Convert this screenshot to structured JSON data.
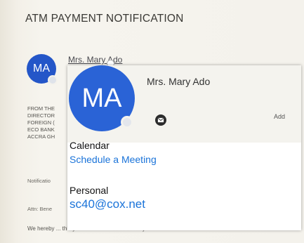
{
  "email": {
    "title": "ATM PAYMENT NOTIFICATION",
    "sender_initials": "MA",
    "sender_name": "Mrs. Mary Ado",
    "body_lines": [
      "FROM THE",
      "DIRECTOR",
      "FOREIGN (",
      "ECO BANK",
      "ACCRA GH"
    ],
    "notification_line": "Notificatio",
    "attn_line": "Attn: Bene",
    "bottom_text": "We hereby ... this your inheritance fund which you"
  },
  "contact_card": {
    "initials": "MA",
    "name": "Mrs. Mary Ado",
    "add_label": "Add",
    "calendar": {
      "label": "Calendar",
      "link": "Schedule a Meeting"
    },
    "personal": {
      "label": "Personal",
      "email": "sc40@cox.net"
    }
  },
  "colors": {
    "avatar": "#2a63d6",
    "link": "#1a73d9"
  }
}
